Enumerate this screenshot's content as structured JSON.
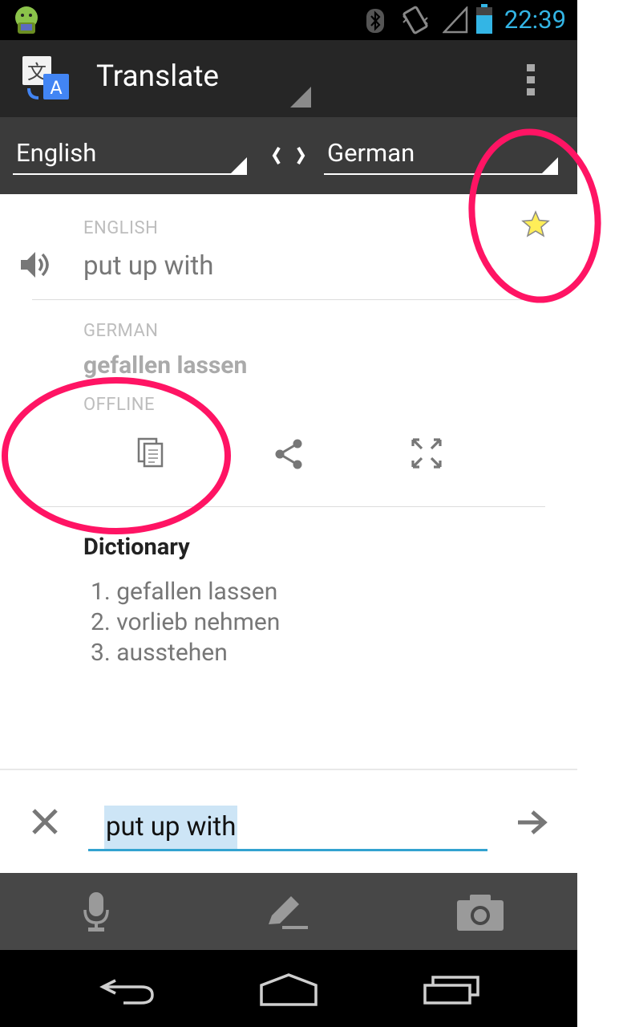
{
  "status_bar": {
    "time": "22:39"
  },
  "app": {
    "title": "Translate"
  },
  "language_bar": {
    "source_language": "English",
    "target_language": "German"
  },
  "source": {
    "language_label": "ENGLISH",
    "text": "put up with"
  },
  "translation": {
    "language_label": "GERMAN",
    "text": "gefallen lassen",
    "mode_label": "OFFLINE"
  },
  "dictionary": {
    "title": "Dictionary",
    "entries": [
      "1. gefallen lassen",
      "2. vorlieb nehmen",
      "3. ausstehen"
    ]
  },
  "input": {
    "value": "put up with"
  },
  "colors": {
    "accent": "#33b5e5",
    "annotation": "#ff1464",
    "star": "#ffee58"
  }
}
